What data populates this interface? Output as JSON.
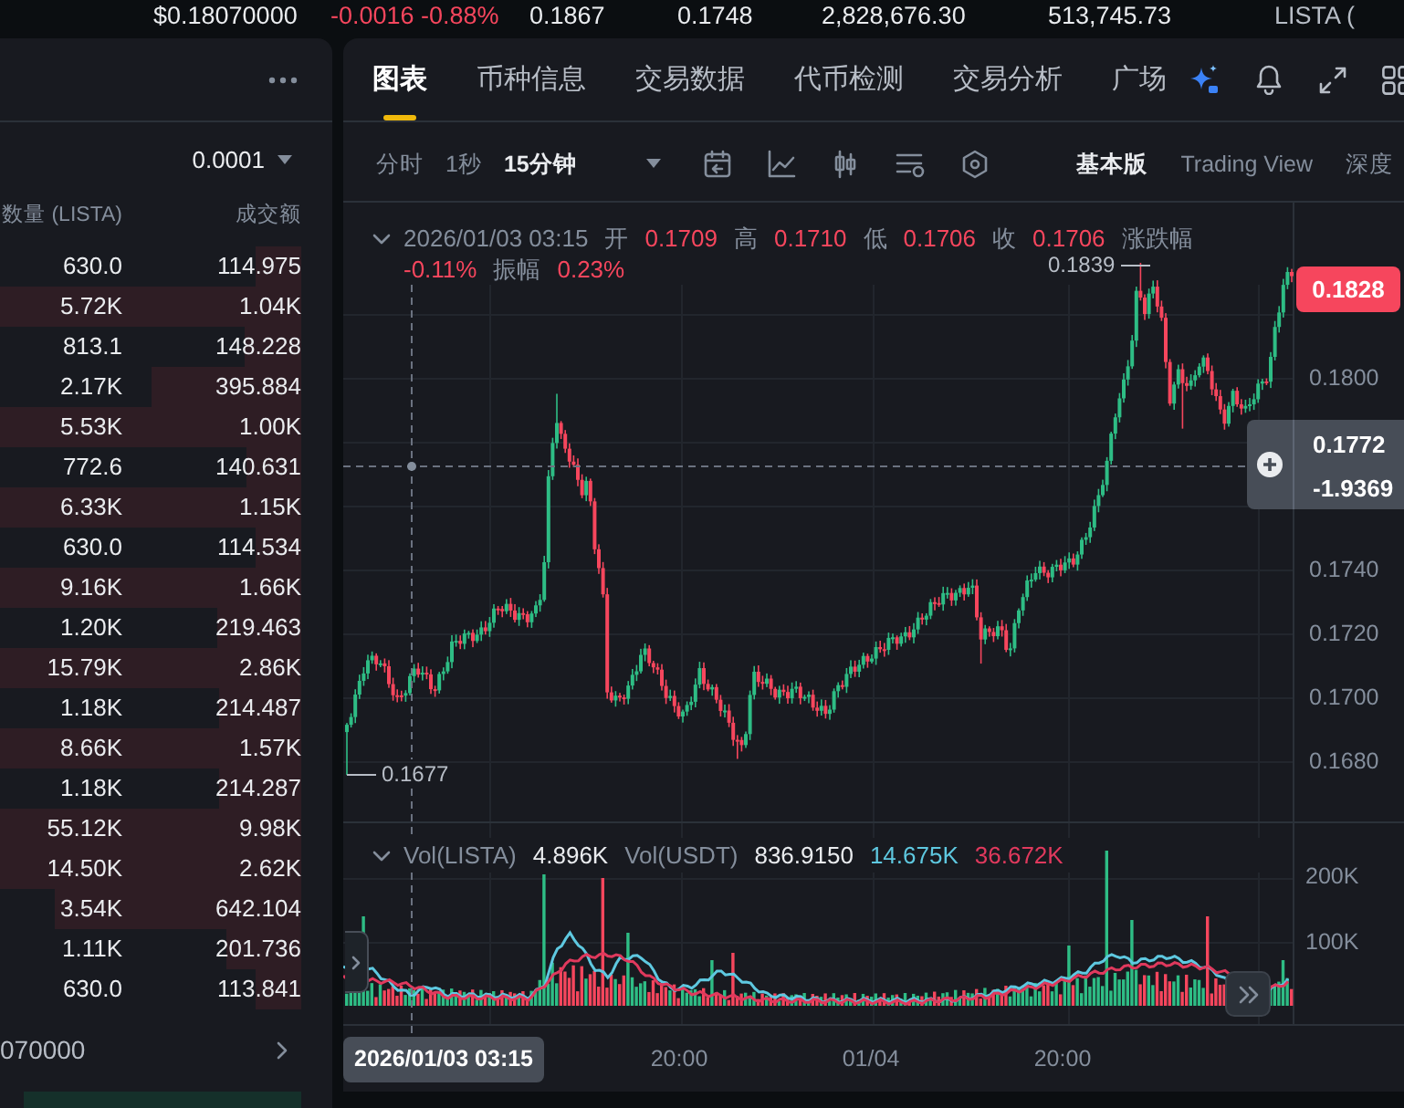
{
  "ticker": [
    {
      "text": "$0.18070000",
      "kind": "price"
    },
    {
      "text": "-0.0016 -0.88%",
      "kind": "change"
    },
    {
      "text": "0.1867",
      "kind": "stat"
    },
    {
      "text": "0.1748",
      "kind": "stat"
    },
    {
      "text": "2,828,676.30",
      "kind": "stat"
    },
    {
      "text": "513,745.73",
      "kind": "stat"
    },
    {
      "text": "LISTA (",
      "kind": "label"
    }
  ],
  "order_book": {
    "precision": "0.0001",
    "columns": [
      "数量 (LISTA)",
      "成交额"
    ],
    "asks": [
      {
        "amount": "630.0",
        "total": "114.975",
        "level": 0.15
      },
      {
        "amount": "5.72K",
        "total": "1.04K",
        "level": 1
      },
      {
        "amount": "813.1",
        "total": "148.228",
        "level": 0.19
      },
      {
        "amount": "2.17K",
        "total": "395.884",
        "level": 0.5
      },
      {
        "amount": "5.53K",
        "total": "1.00K",
        "level": 1
      },
      {
        "amount": "772.6",
        "total": "140.631",
        "level": 0.18
      },
      {
        "amount": "6.33K",
        "total": "1.15K",
        "level": 1
      },
      {
        "amount": "630.0",
        "total": "114.534",
        "level": 0.15
      },
      {
        "amount": "9.16K",
        "total": "1.66K",
        "level": 1
      },
      {
        "amount": "1.20K",
        "total": "219.463",
        "level": 0.28
      },
      {
        "amount": "15.79K",
        "total": "2.86K",
        "level": 1
      },
      {
        "amount": "1.18K",
        "total": "214.487",
        "level": 0.27
      },
      {
        "amount": "8.66K",
        "total": "1.57K",
        "level": 1
      },
      {
        "amount": "1.18K",
        "total": "214.287",
        "level": 0.27
      },
      {
        "amount": "55.12K",
        "total": "9.98K",
        "level": 1
      },
      {
        "amount": "14.50K",
        "total": "2.62K",
        "level": 1
      },
      {
        "amount": "3.54K",
        "total": "642.104",
        "level": 0.82
      },
      {
        "amount": "1.11K",
        "total": "201.736",
        "level": 0.25
      },
      {
        "amount": "630.0",
        "total": "113.841",
        "level": 0.15
      }
    ],
    "mark_price": "070000",
    "bids": [
      {
        "level": 0.92
      }
    ]
  },
  "chart_tabs": [
    {
      "label": "图表",
      "selected": true
    },
    {
      "label": "币种信息",
      "selected": false
    },
    {
      "label": "交易数据",
      "selected": false
    },
    {
      "label": "代币检测",
      "selected": false
    },
    {
      "label": "交易分析",
      "selected": false
    },
    {
      "label": "广场",
      "selected": false
    }
  ],
  "toolbar": {
    "intervals": [
      {
        "label": "分时",
        "selected": false
      },
      {
        "label": "1秒",
        "selected": false
      },
      {
        "label": "15分钟",
        "selected": true
      }
    ],
    "views": [
      {
        "label": "基本版",
        "selected": true
      },
      {
        "label": "Trading View",
        "selected": false
      },
      {
        "label": "深度",
        "selected": false
      }
    ]
  },
  "chart": {
    "legend": [
      {
        "text": "2026/01/03 03:15",
        "kind": "time"
      },
      {
        "text": "开",
        "kind": "label"
      },
      {
        "text": "0.1709",
        "kind": "value"
      },
      {
        "text": "高",
        "kind": "label"
      },
      {
        "text": "0.1710",
        "kind": "value"
      },
      {
        "text": "低",
        "kind": "label"
      },
      {
        "text": "0.1706",
        "kind": "value"
      },
      {
        "text": "收",
        "kind": "label"
      },
      {
        "text": "0.1706",
        "kind": "value"
      },
      {
        "text": "涨跌幅",
        "kind": "label"
      },
      {
        "text": "-0.11%",
        "kind": "value"
      },
      {
        "text": "振幅",
        "kind": "label"
      },
      {
        "text": "0.23%",
        "kind": "value"
      }
    ],
    "high_label": "0.1839",
    "low_label": "0.1677",
    "last_price": "0.1828",
    "crosshair": {
      "price": "0.1772",
      "change": "-1.9369",
      "time": "2026/01/03 03:15"
    },
    "price_axis": [
      "0.1800",
      "0.1740",
      "0.1720",
      "0.1700",
      "0.1680"
    ],
    "volume_legend": [
      {
        "text": "Vol(LISTA)",
        "kind": "label"
      },
      {
        "text": "4.896K",
        "kind": "value"
      },
      {
        "text": "Vol(USDT)",
        "kind": "label"
      },
      {
        "text": "836.9150",
        "kind": "value"
      },
      {
        "text": "14.675K",
        "kind": "ma",
        "color": "#5ec8e0"
      },
      {
        "text": "36.672K",
        "kind": "ma",
        "color": "#e0395d"
      }
    ],
    "volume_axis": [
      "200K",
      "100K"
    ],
    "time_axis": [
      "20:00",
      "01/04",
      "20:00"
    ]
  }
}
